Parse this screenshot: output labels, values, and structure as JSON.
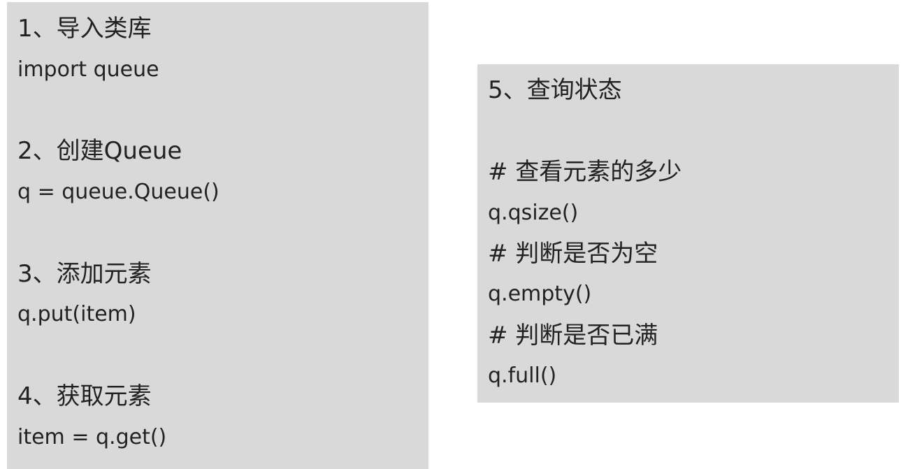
{
  "left_panel": {
    "lines": [
      {
        "role": "heading",
        "text": "1、导入类库"
      },
      {
        "role": "code",
        "text": "import queue"
      },
      {
        "role": "heading",
        "text": "2、创建Queue"
      },
      {
        "role": "code",
        "text": "q = queue.Queue()"
      },
      {
        "role": "heading",
        "text": "3、添加元素"
      },
      {
        "role": "code",
        "text": "q.put(item)"
      },
      {
        "role": "heading",
        "text": "4、获取元素"
      },
      {
        "role": "code",
        "text": "item = q.get()"
      }
    ]
  },
  "right_panel": {
    "lines": [
      {
        "role": "heading",
        "text": "5、查询状态"
      },
      {
        "role": "comment",
        "text": "# 查看元素的多少"
      },
      {
        "role": "code",
        "text": "q.qsize()"
      },
      {
        "role": "comment",
        "text": "# 判断是否为空"
      },
      {
        "role": "code",
        "text": "q.empty()"
      },
      {
        "role": "comment",
        "text": "# 判断是否已满"
      },
      {
        "role": "code",
        "text": "q.full()"
      }
    ]
  }
}
